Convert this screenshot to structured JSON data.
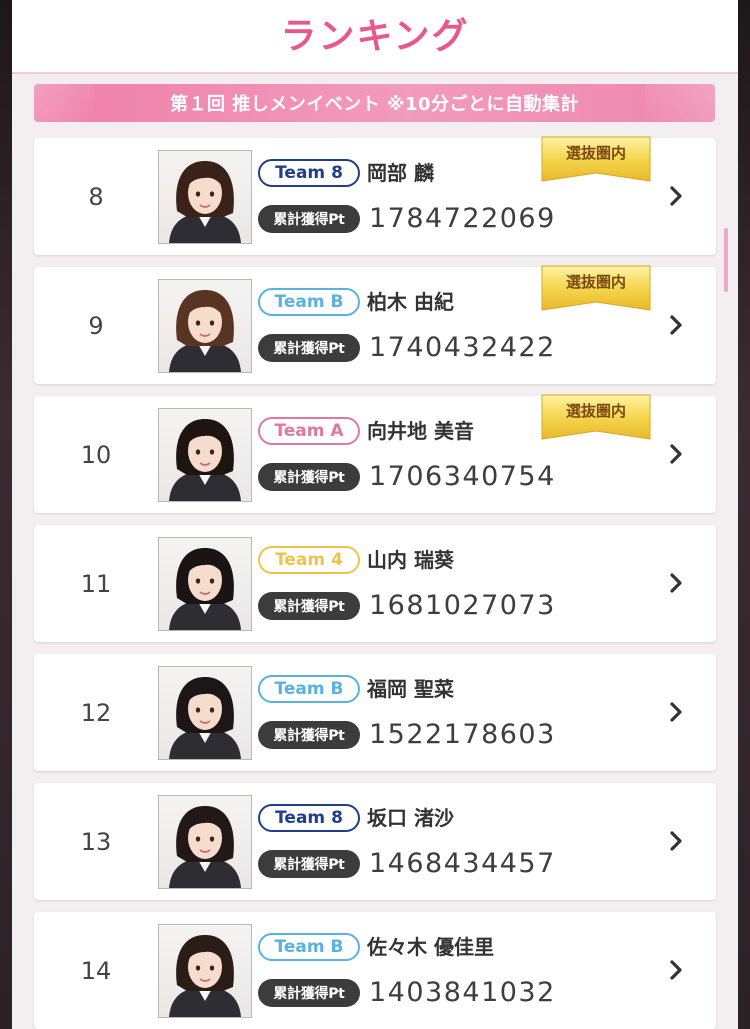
{
  "header": {
    "title": "ランキング"
  },
  "banner": {
    "text": "第１回 推しメンイベント ※10分ごとに自動集計"
  },
  "badge_label": "選抜圏内",
  "points_label": "累計獲得Pt",
  "team_colors": {
    "Team 8": "#1f3f8a",
    "Team B": "#59b2e0",
    "Team A": "#e2779f",
    "Team 4": "#f0c34a"
  },
  "rows": [
    {
      "rank": "8",
      "team": "Team 8",
      "name": "岡部 麟",
      "points": "1784722069",
      "selected": true
    },
    {
      "rank": "9",
      "team": "Team B",
      "name": "柏木 由紀",
      "points": "1740432422",
      "selected": true
    },
    {
      "rank": "10",
      "team": "Team A",
      "name": "向井地 美音",
      "points": "1706340754",
      "selected": true
    },
    {
      "rank": "11",
      "team": "Team 4",
      "name": "山内 瑞葵",
      "points": "1681027073",
      "selected": false
    },
    {
      "rank": "12",
      "team": "Team B",
      "name": "福岡 聖菜",
      "points": "1522178603",
      "selected": false
    },
    {
      "rank": "13",
      "team": "Team 8",
      "name": "坂口 渚沙",
      "points": "1468434457",
      "selected": false
    },
    {
      "rank": "14",
      "team": "Team B",
      "name": "佐々木 優佳里",
      "points": "1403841032",
      "selected": false
    }
  ]
}
